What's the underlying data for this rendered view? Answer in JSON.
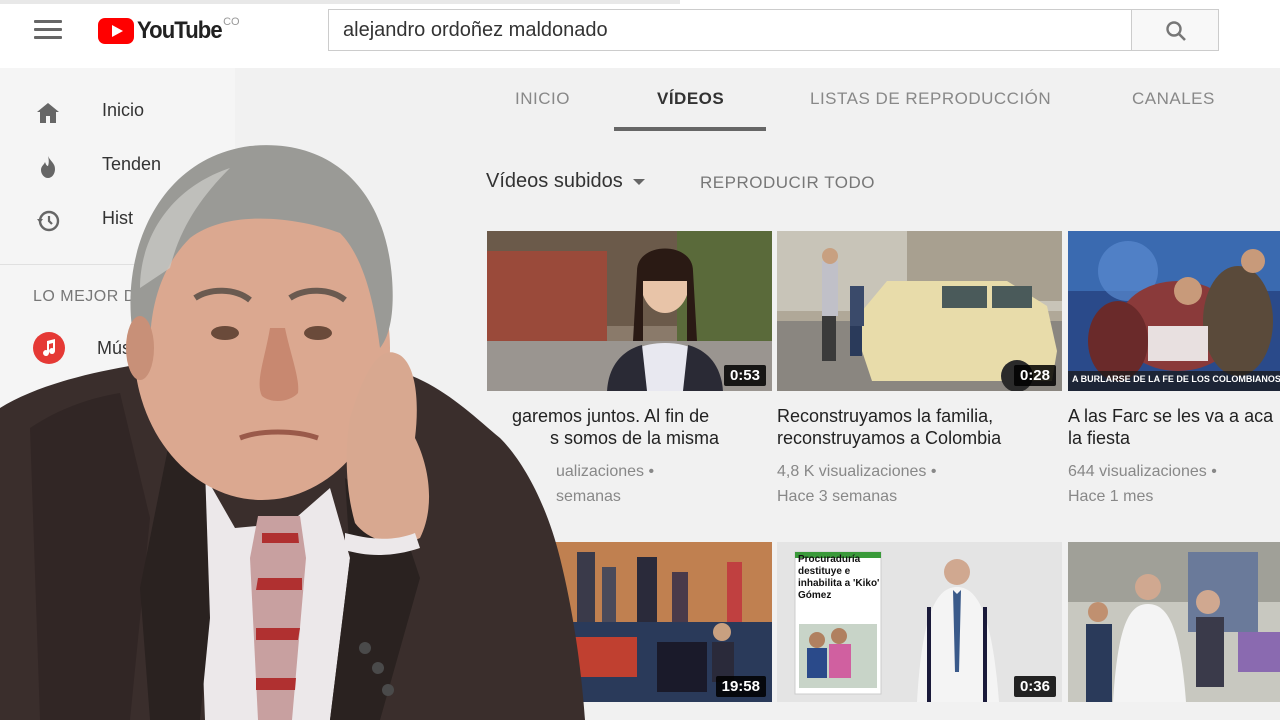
{
  "header": {
    "logo_text": "YouTube",
    "logo_country": "CO",
    "search_query": "alejandro ordoñez maldonado"
  },
  "sidebar": {
    "items": [
      {
        "label": "Inicio",
        "icon": "home-icon"
      },
      {
        "label": "Tenden",
        "icon": "flame-icon"
      },
      {
        "label": "Hist",
        "icon": "history-icon"
      }
    ],
    "section_heading": "LO MEJOR D",
    "music_label": "Mús"
  },
  "tabs": [
    {
      "label": "INICIO",
      "active": false
    },
    {
      "label": "VÍDEOS",
      "active": true
    },
    {
      "label": "LISTAS DE REPRODUCCIÓN",
      "active": false
    },
    {
      "label": "CANALES",
      "active": false
    }
  ],
  "filter": {
    "selected": "Vídeos subidos",
    "play_all": "REPRODUCIR TODO"
  },
  "videos": [
    {
      "title_line1": "garemos juntos. Al fin de",
      "title_line2": "s somos de la misma",
      "views": "ualizaciones •",
      "age": "semanas",
      "duration": "0:53"
    },
    {
      "title_line1": "Reconstruyamos la familia,",
      "title_line2": "reconstruyamos a Colombia",
      "views": "4,8 K visualizaciones •",
      "age": "Hace 3 semanas",
      "duration": "0:28"
    },
    {
      "title_line1": "A las Farc se les va a aca",
      "title_line2": "la fiesta",
      "views": "644 visualizaciones •",
      "age": "Hace 1 mes",
      "duration": "",
      "caption": "A BURLARSE DE LA FE DE LOS COLOMBIANOS"
    },
    {
      "duration": "19:58"
    },
    {
      "duration": "0:36",
      "poster_text": "Procuraduría destituye e inhabilita a 'Kiko' Gómez"
    },
    {
      "duration": ""
    }
  ],
  "colors": {
    "brand_red": "#ff0000",
    "music_red": "#e53935"
  }
}
